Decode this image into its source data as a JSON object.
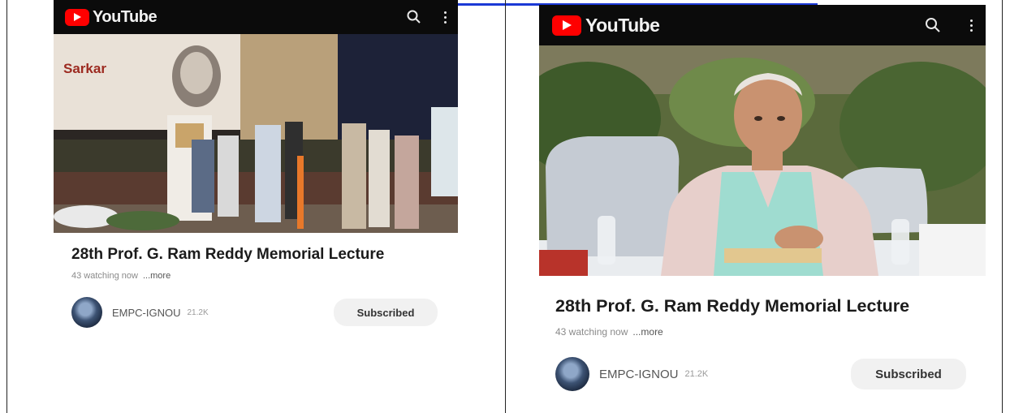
{
  "colors": {
    "youtube_red": "#ff0000",
    "bar_bg": "#0b0b0b",
    "link_blue": "#1b39d6"
  },
  "icons": [
    "youtube-logo-icon",
    "search-icon",
    "more-vert-icon",
    "avatar"
  ],
  "panels": [
    {
      "logo_text": "YouTube",
      "video_sign_text": "Sarkar",
      "title": "28th Prof. G. Ram Reddy Memorial Lecture",
      "watching": "43 watching now",
      "more": "...more",
      "channel": "EMPC-IGNOU",
      "subscribers": "21.2K",
      "subscribe_button": "Subscribed"
    },
    {
      "logo_text": "YouTube",
      "title": "28th Prof. G. Ram Reddy Memorial Lecture",
      "watching": "43 watching now",
      "more": "...more",
      "channel": "EMPC-IGNOU",
      "subscribers": "21.2K",
      "subscribe_button": "Subscribed"
    }
  ]
}
